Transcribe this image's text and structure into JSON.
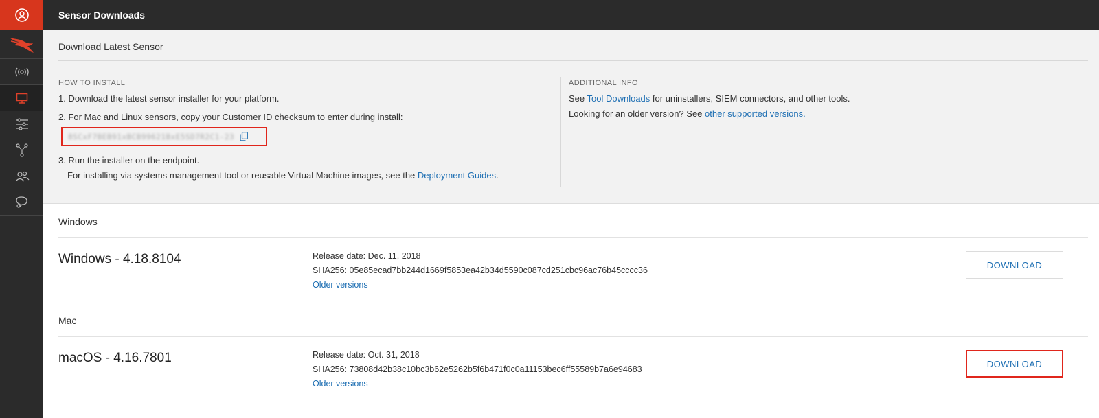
{
  "header": {
    "title": "Sensor Downloads"
  },
  "sidebar": {
    "items": [
      {
        "icon": "radio-signal-icon"
      },
      {
        "icon": "computer-icon",
        "active": true
      },
      {
        "icon": "sliders-icon"
      },
      {
        "icon": "network-icon"
      },
      {
        "icon": "users-icon"
      },
      {
        "icon": "chat-support-icon"
      }
    ]
  },
  "install_panel": {
    "title": "Download Latest Sensor",
    "how_to_label": "HOW TO INSTALL",
    "step1": "1. Download the latest sensor installer for your platform.",
    "step2": "2. For Mac and Linux sensors, copy your Customer ID checksum to enter during install:",
    "customer_id": "8SCxF7BEB91xBCB99621BxE5SD7R2C1-23",
    "step3": "3. Run the installer on the endpoint.",
    "step3_note_prefix": "For installing via systems management tool or reusable Virtual Machine images, see the ",
    "step3_note_link": "Deployment Guides",
    "step3_note_suffix": ".",
    "additional_label": "ADDITIONAL INFO",
    "info1_prefix": "See ",
    "info1_link": "Tool Downloads",
    "info1_suffix": " for uninstallers, SIEM connectors, and other tools.",
    "info2_prefix": "Looking for an older version? See ",
    "info2_link": "other supported versions.",
    "info2_suffix": ""
  },
  "downloads": {
    "windows": {
      "group": "Windows",
      "name": "Windows - 4.18.8104",
      "release": "Release date: Dec. 11, 2018",
      "sha": "SHA256: 05e85ecad7bb244d1669f5853ea42b34d5590c087cd251cbc96ac76b45cccc36",
      "older": "Older versions",
      "button": "DOWNLOAD"
    },
    "mac": {
      "group": "Mac",
      "name": "macOS - 4.16.7801",
      "release": "Release date: Oct. 31, 2018",
      "sha": "SHA256: 73808d42b38c10bc3b62e5262b5f6b471f0c0a11153bec6ff55589b7a6e94683",
      "older": "Older versions",
      "button": "DOWNLOAD"
    }
  },
  "colors": {
    "accent": "#d7361d",
    "link": "#1e6fb3",
    "sidebar": "#2b2b2b",
    "highlight": "#e0261c"
  }
}
